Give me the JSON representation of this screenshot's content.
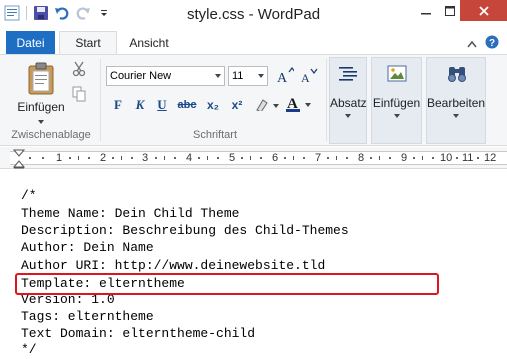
{
  "window": {
    "title": "style.css - WordPad"
  },
  "tabs": {
    "datei": "Datei",
    "start": "Start",
    "ansicht": "Ansicht"
  },
  "ribbon": {
    "clipboard": {
      "paste_label": "Einfügen",
      "group_label": "Zwischenablage"
    },
    "font": {
      "font_name": "Courier New",
      "font_size": "11",
      "group_label": "Schriftart",
      "bold": "F",
      "italic": "K",
      "underline": "U",
      "strike": "abc",
      "sub": "x₂",
      "sup": "x²"
    },
    "paragraph_label": "Absatz",
    "insert_label": "Einfügen",
    "edit_label": "Bearbeiten"
  },
  "ruler": {
    "numbers": [
      "1",
      "2",
      "3",
      "4",
      "5",
      "6",
      "7",
      "8",
      "9",
      "10",
      "11",
      "12"
    ]
  },
  "document": {
    "lines": [
      "/*",
      "Theme Name: Dein Child Theme",
      "Description: Beschreibung des Child-Themes",
      "Author: Dein Name",
      "Author URI: http://www.deinewebsite.tld",
      "Template: elterntheme",
      "Version: 1.0",
      "Tags: elterntheme",
      "Text Domain: elterntheme-child",
      "*/"
    ]
  },
  "colors": {
    "accent": "#1e6fc4",
    "close": "#c7463c",
    "highlight": "#e0141e"
  }
}
